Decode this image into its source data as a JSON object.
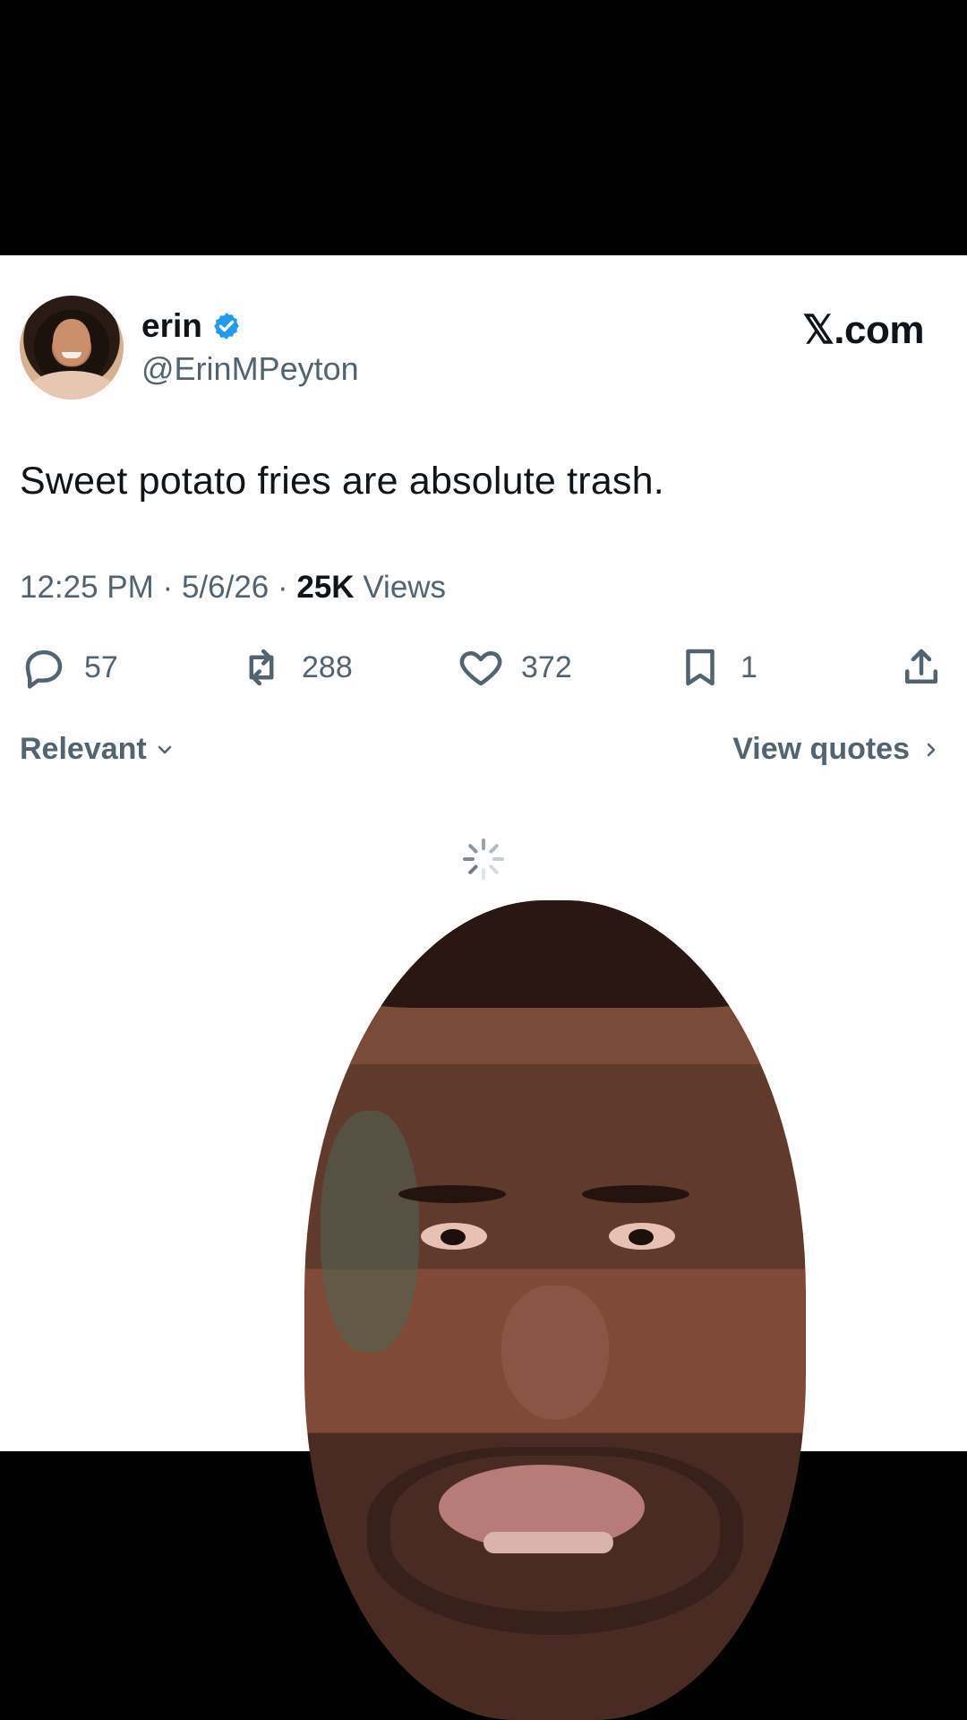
{
  "post": {
    "author_name": "erin",
    "author_handle": "@ErinMPeyton",
    "site_logo": "𝕏.com",
    "text": "Sweet potato fries are absolute trash.",
    "time": "12:25 PM",
    "date": "5/6/26",
    "views_count": "25K",
    "views_label": "Views",
    "separator": "·"
  },
  "actions": {
    "replies": "57",
    "reposts": "288",
    "likes": "372",
    "bookmarks": "1"
  },
  "controls": {
    "sort_label": "Relevant",
    "quotes_label": "View quotes"
  },
  "icons": {
    "verified": "verified-icon",
    "reply": "reply-icon",
    "repost": "repost-icon",
    "like": "heart-icon",
    "bookmark": "bookmark-icon",
    "share": "share-icon",
    "chevron_down": "chevron-down-icon",
    "chevron_right": "chevron-right-icon",
    "spinner": "loading-spinner-icon"
  },
  "colors": {
    "text_primary": "#0f1419",
    "text_secondary": "#536471",
    "verified_blue": "#1d9bf0",
    "background": "#ffffff",
    "letterbox": "#000000"
  }
}
